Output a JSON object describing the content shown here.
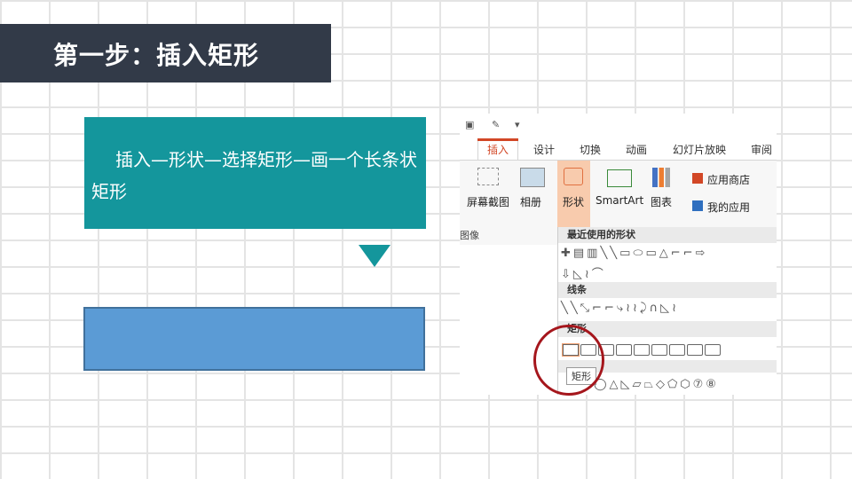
{
  "slide": {
    "title": "第一步：插入矩形",
    "instruction": "插入—形状—选择矩形—画一个长条状矩形"
  },
  "ribbon": {
    "tabs": [
      "插入",
      "设计",
      "切换",
      "动画",
      "幻灯片放映",
      "审阅"
    ],
    "active_tab": "插入",
    "buttons": {
      "screenshot": "屏幕截图",
      "album": "相册",
      "shapes": "形状",
      "smartart": "SmartArt",
      "chart": "图表",
      "store": "应用商店",
      "my_apps": "我的应用"
    },
    "group_label": "图像"
  },
  "shapes_menu": {
    "recent": "最近使用的形状",
    "lines": "线条",
    "rectangles": "矩形",
    "tooltip": "矩形"
  },
  "colors": {
    "title_bg": "#323a48",
    "teal": "#14969c",
    "blue_rect": "#5b9bd5",
    "accent": "#d24726",
    "circle": "#a5161c"
  }
}
